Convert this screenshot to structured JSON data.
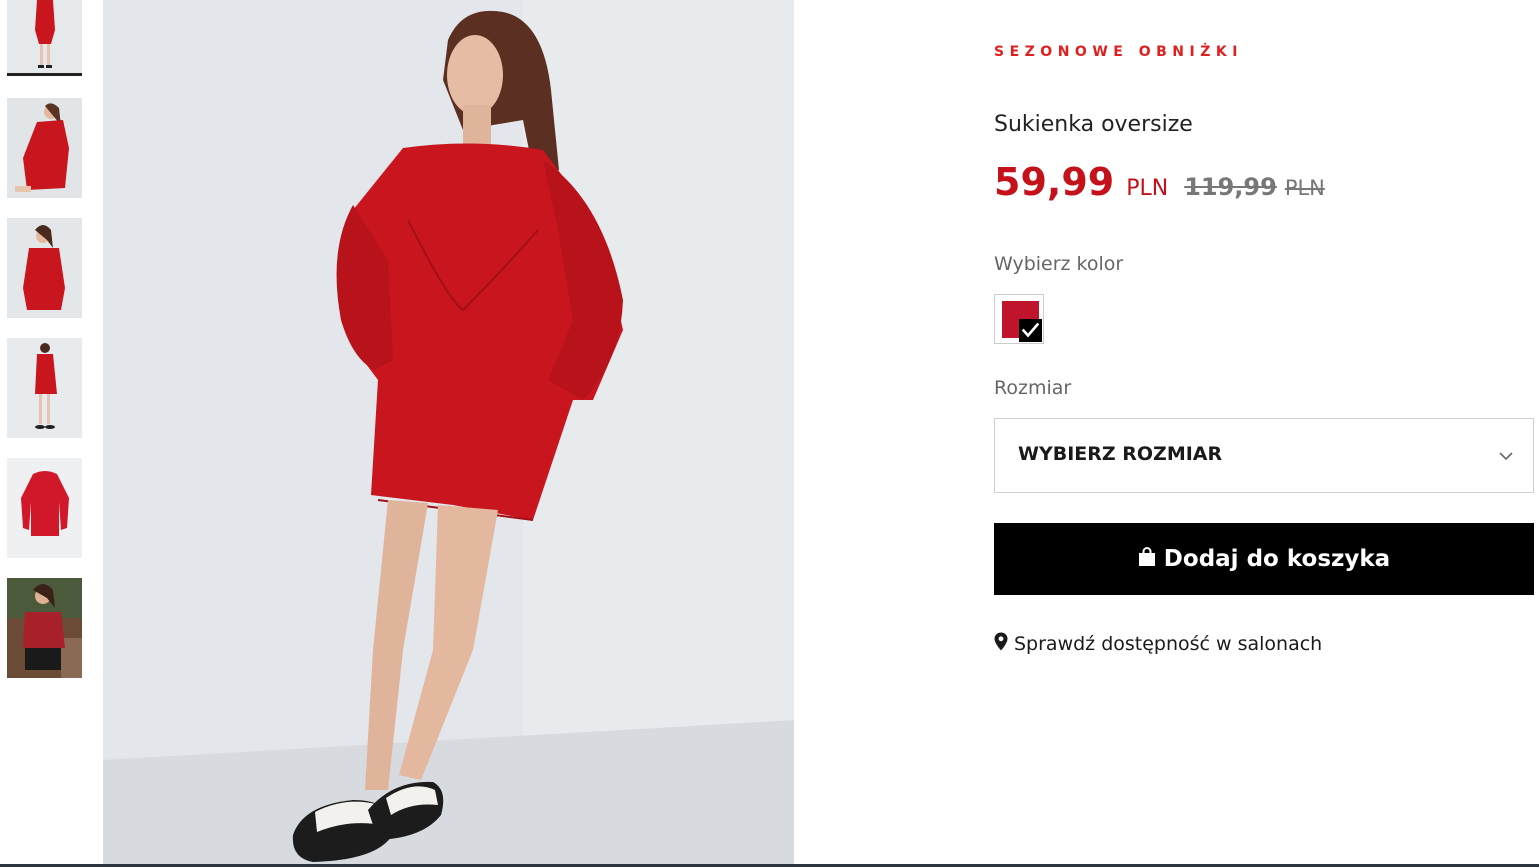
{
  "product": {
    "promo_label": "SEZONOWE OBNIŻKI",
    "title": "Sukienka oversize",
    "price_new": "59,99",
    "price_currency": "PLN",
    "price_old": "119,99",
    "price_old_currency": "PLN"
  },
  "color": {
    "label": "Wybierz kolor",
    "selected_hex": "#c0132c"
  },
  "size": {
    "label": "Rozmiar",
    "placeholder": "WYBIERZ ROZMIAR"
  },
  "cart": {
    "button_label": "Dodaj do koszyka",
    "icon": "shopping-bag-icon"
  },
  "stores": {
    "link_label": "Sprawdź dostępność w salonach",
    "icon": "map-pin-icon"
  },
  "gallery": {
    "thumbnails": [
      "thumbnail-1",
      "thumbnail-2",
      "thumbnail-3",
      "thumbnail-4",
      "thumbnail-5",
      "thumbnail-6"
    ],
    "active_index": 0
  },
  "colors": {
    "promo": "#e01f1f",
    "price": "#c4111a",
    "dress": "#c8151e",
    "button": "#000000"
  }
}
